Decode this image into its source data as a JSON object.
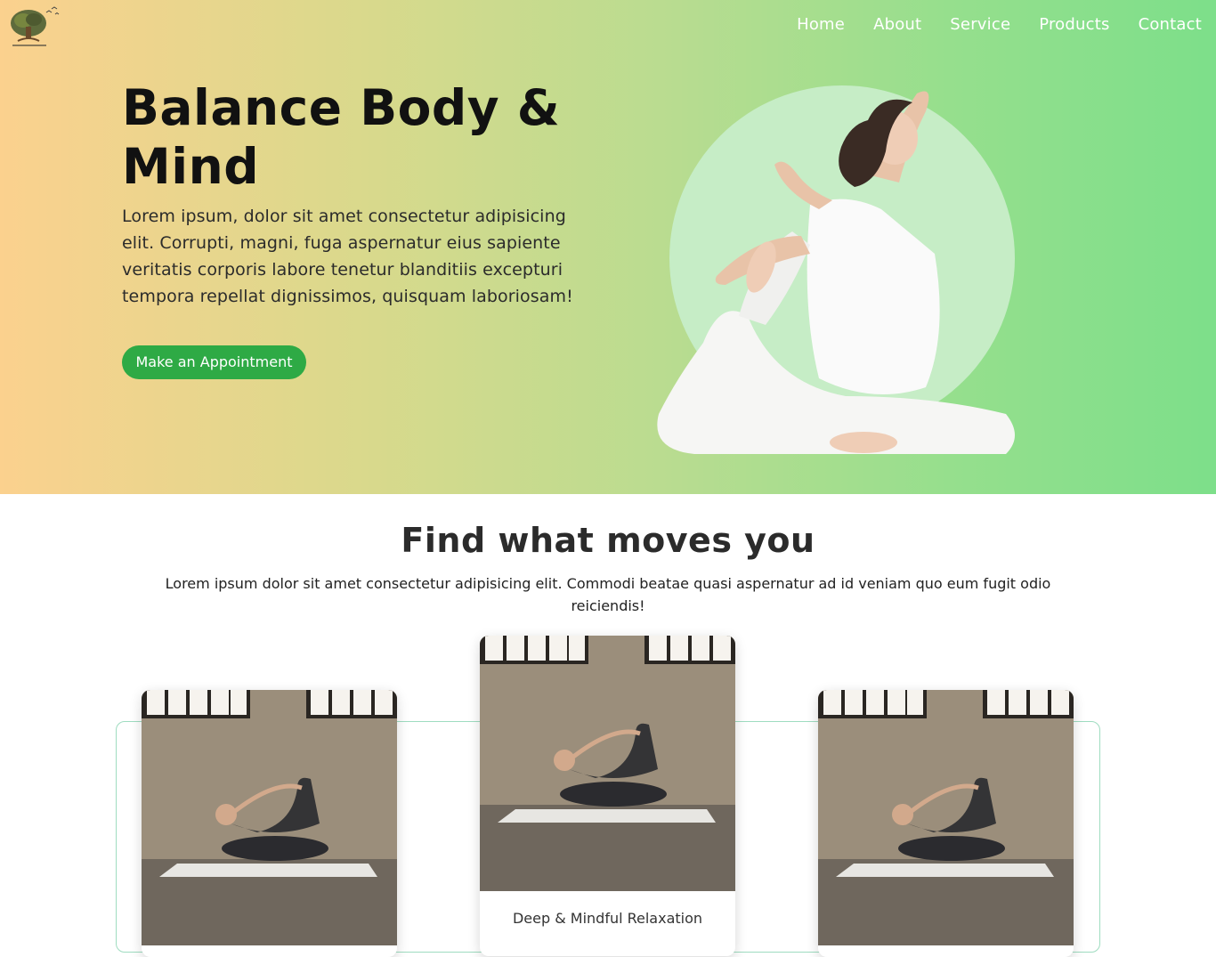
{
  "nav": {
    "items": [
      "Home",
      "About",
      "Service",
      "Products",
      "Contact"
    ]
  },
  "hero": {
    "title": "Balance Body & Mind",
    "text": "Lorem ipsum, dolor sit amet consectetur adipisicing elit. Corrupti, magni, fuga aspernatur eius sapiente veritatis corporis labore tenetur blanditiis excepturi tempora repellat dignissimos, quisquam laboriosam!",
    "cta_label": "Make an Appointment"
  },
  "section": {
    "title": "Find what moves you",
    "text": "Lorem ipsum dolor sit amet consectetur adipisicing elit. Commodi beatae quasi aspernatur ad id veniam quo eum fugit odio reiciendis!"
  },
  "cards": [
    {
      "label": ""
    },
    {
      "label": "Deep & Mindful Relaxation"
    },
    {
      "label": ""
    }
  ],
  "colors": {
    "accent": "#2eaa45",
    "gradient_start": "#fbd18e",
    "gradient_end": "#7ddf8a"
  }
}
